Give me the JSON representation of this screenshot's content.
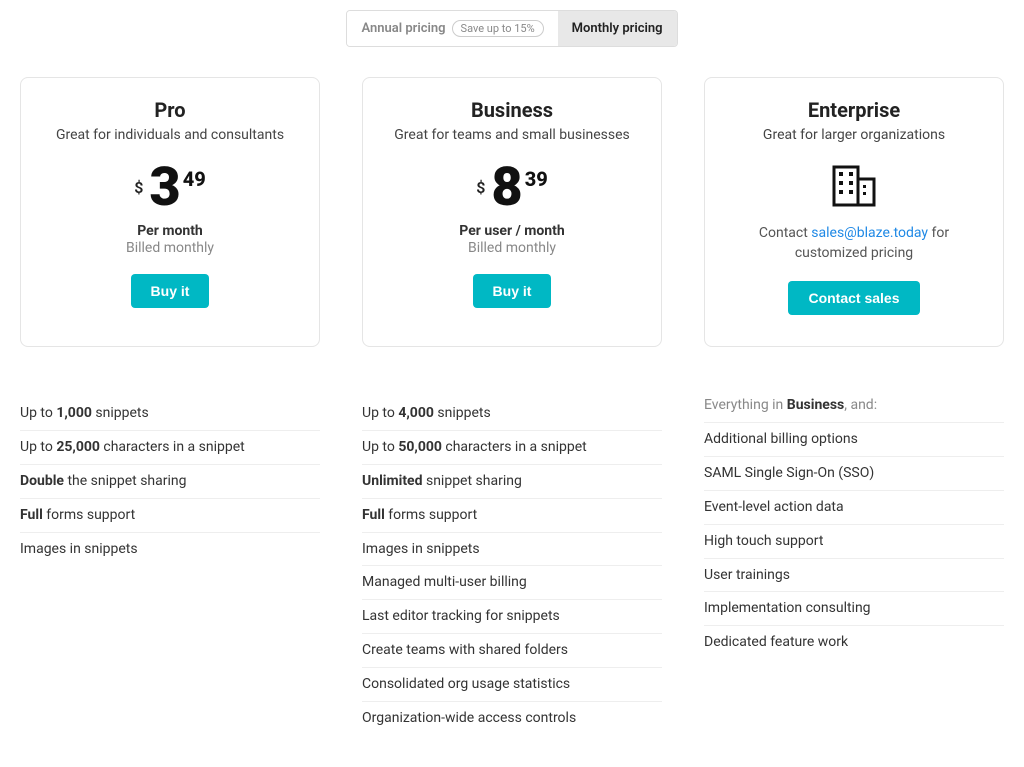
{
  "billing_toggle": {
    "annual_label": "Annual pricing",
    "annual_badge": "Save up to 15%",
    "monthly_label": "Monthly pricing"
  },
  "plans": {
    "pro": {
      "title": "Pro",
      "subtitle": "Great for individuals and consultants",
      "currency": "$",
      "price_main": "3",
      "price_cents": "49",
      "per_label": "Per month",
      "billed_label": "Billed monthly",
      "cta": "Buy it",
      "features": [
        {
          "pre": "Up to ",
          "bold": "1,000",
          "post": " snippets"
        },
        {
          "pre": "Up to ",
          "bold": "25,000",
          "post": " characters in a snippet"
        },
        {
          "pre": "",
          "bold": "Double",
          "post": " the snippet sharing"
        },
        {
          "pre": "",
          "bold": "Full",
          "post": " forms support"
        },
        {
          "pre": "Images in snippets",
          "bold": "",
          "post": ""
        }
      ]
    },
    "business": {
      "title": "Business",
      "subtitle": "Great for teams and small businesses",
      "currency": "$",
      "price_main": "8",
      "price_cents": "39",
      "per_label": "Per user / month",
      "billed_label": "Billed monthly",
      "cta": "Buy it",
      "features": [
        {
          "pre": "Up to ",
          "bold": "4,000",
          "post": " snippets"
        },
        {
          "pre": "Up to ",
          "bold": "50,000",
          "post": " characters in a snippet"
        },
        {
          "pre": "",
          "bold": "Unlimited",
          "post": " snippet sharing"
        },
        {
          "pre": "",
          "bold": "Full",
          "post": " forms support"
        },
        {
          "pre": "Images in snippets",
          "bold": "",
          "post": ""
        },
        {
          "pre": "Managed multi-user billing",
          "bold": "",
          "post": ""
        },
        {
          "pre": "Last editor tracking for snippets",
          "bold": "",
          "post": ""
        },
        {
          "pre": "Create teams with shared folders",
          "bold": "",
          "post": ""
        },
        {
          "pre": "Consolidated org usage statistics",
          "bold": "",
          "post": ""
        },
        {
          "pre": "Organization-wide access controls",
          "bold": "",
          "post": ""
        }
      ]
    },
    "enterprise": {
      "title": "Enterprise",
      "subtitle": "Great for larger organizations",
      "contact_pre": "Contact ",
      "contact_email": "sales@blaze.today",
      "contact_post": " for customized pricing",
      "cta": "Contact sales",
      "intro_pre": "Everything in ",
      "intro_bold": "Business",
      "intro_post": ", and:",
      "features": [
        "Additional billing options",
        "SAML Single Sign-On (SSO)",
        "Event-level action data",
        "High touch support",
        "User trainings",
        "Implementation consulting",
        "Dedicated feature work"
      ]
    }
  }
}
